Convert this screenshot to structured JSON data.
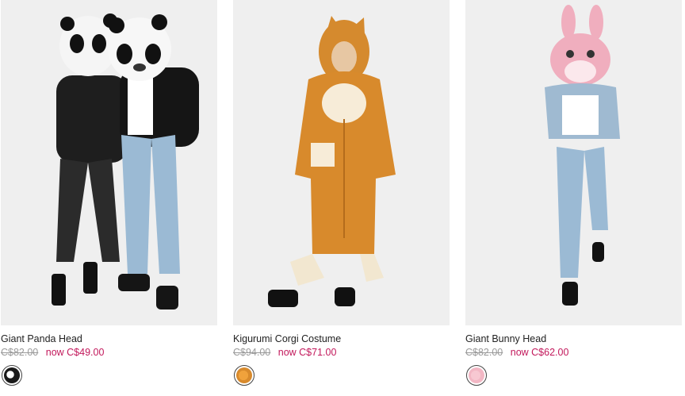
{
  "products": [
    {
      "title": "Giant Panda Head",
      "old_price": "C$82.00",
      "new_price": "now C$49.00",
      "image": "two people wearing giant panda heads",
      "swatch_color": "#1a1a1a"
    },
    {
      "title": "Kigurumi Corgi Costume",
      "old_price": "C$94.00",
      "new_price": "now C$71.00",
      "image": "person wearing orange corgi kigurumi",
      "swatch_color": "#d88a2c"
    },
    {
      "title": "Giant Bunny Head",
      "old_price": "C$82.00",
      "new_price": "now C$62.00",
      "image": "person wearing pink bunny head",
      "swatch_color": "#f2b7c4"
    }
  ],
  "colors": {
    "sale": "#c2185b",
    "strike": "#9a9a9a",
    "photo_bg": "#efefef"
  }
}
